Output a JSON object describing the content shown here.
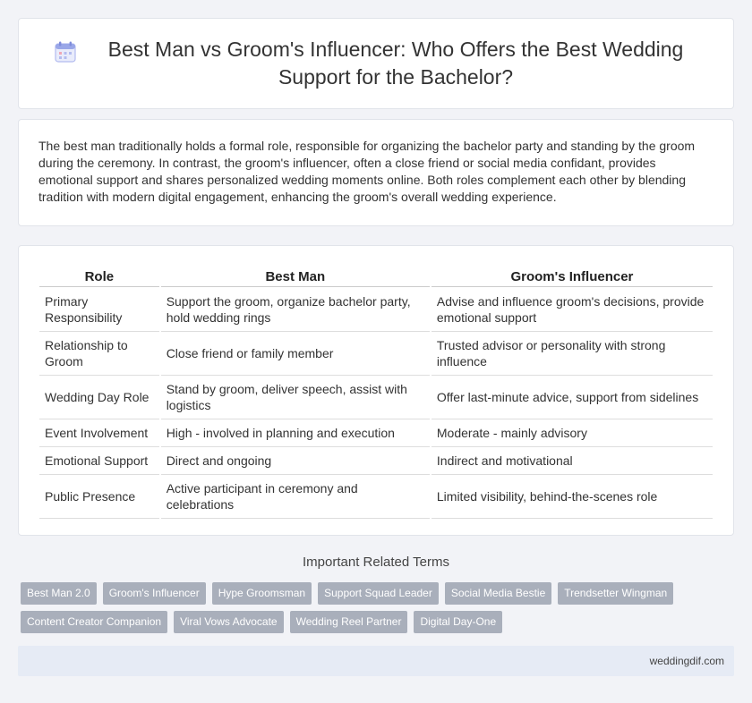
{
  "header": {
    "icon": "calendar-icon",
    "title": "Best Man vs Groom's Influencer: Who Offers the Best Wedding Support for the Bachelor?"
  },
  "intro": {
    "text": "The best man traditionally holds a formal role, responsible for organizing the bachelor party and standing by the groom during the ceremony. In contrast, the groom's influencer, often a close friend or social media confidant, provides emotional support and shares personalized wedding moments online. Both roles complement each other by blending tradition with modern digital engagement, enhancing the groom's overall wedding experience."
  },
  "table": {
    "headers": [
      "Role",
      "Best Man",
      "Groom's Influencer"
    ],
    "rows": [
      [
        "Primary Responsibility",
        "Support the groom, organize bachelor party, hold wedding rings",
        "Advise and influence groom's decisions, provide emotional support"
      ],
      [
        "Relationship to Groom",
        "Close friend or family member",
        "Trusted advisor or personality with strong influence"
      ],
      [
        "Wedding Day Role",
        "Stand by groom, deliver speech, assist with logistics",
        "Offer last-minute advice, support from sidelines"
      ],
      [
        "Event Involvement",
        "High - involved in planning and execution",
        "Moderate - mainly advisory"
      ],
      [
        "Emotional Support",
        "Direct and ongoing",
        "Indirect and motivational"
      ],
      [
        "Public Presence",
        "Active participant in ceremony and celebrations",
        "Limited visibility, behind-the-scenes role"
      ]
    ]
  },
  "related": {
    "title": "Important Related Terms",
    "tags": [
      "Best Man 2.0",
      "Groom's Influencer",
      "Hype Groomsman",
      "Support Squad Leader",
      "Social Media Bestie",
      "Trendsetter Wingman",
      "Content Creator Companion",
      "Viral Vows Advocate",
      "Wedding Reel Partner",
      "Digital Day-One"
    ]
  },
  "footer": {
    "site": "weddingdif.com"
  },
  "colors": {
    "background": "#f2f3f7",
    "tag_bg": "#a9afbb",
    "footer_bg": "#e6ebf5",
    "icon_accent": "#9aa7e8"
  }
}
